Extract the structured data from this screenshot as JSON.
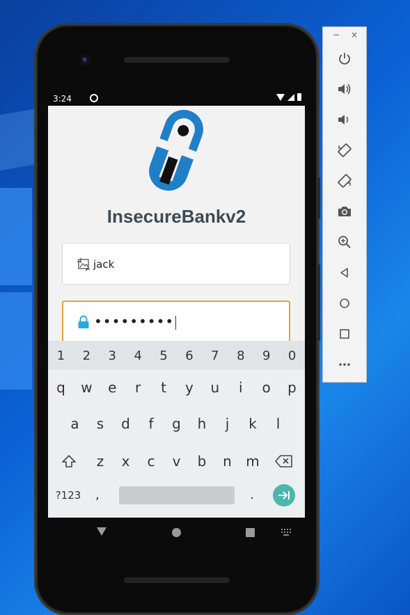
{
  "status_bar": {
    "time": "3:24"
  },
  "app": {
    "title": "InsecureBankv2",
    "username_value": "jack",
    "password_value": "•••••••••"
  },
  "keyboard": {
    "number_row": [
      "1",
      "2",
      "3",
      "4",
      "5",
      "6",
      "7",
      "8",
      "9",
      "0"
    ],
    "row1": [
      "q",
      "w",
      "e",
      "r",
      "t",
      "y",
      "u",
      "i",
      "o",
      "p"
    ],
    "row2": [
      "a",
      "s",
      "d",
      "f",
      "g",
      "h",
      "j",
      "k",
      "l"
    ],
    "row3": [
      "z",
      "x",
      "c",
      "v",
      "b",
      "n",
      "m"
    ],
    "symbols_label": "?123",
    "comma": ",",
    "period": "."
  },
  "emulator_toolbar": {
    "minimize": "−",
    "close": "×"
  },
  "colors": {
    "logo_blue": "#1f7fc7",
    "password_border": "#e2a33a",
    "enter_key": "#4db6ac",
    "lock_icon": "#29a9e0"
  }
}
